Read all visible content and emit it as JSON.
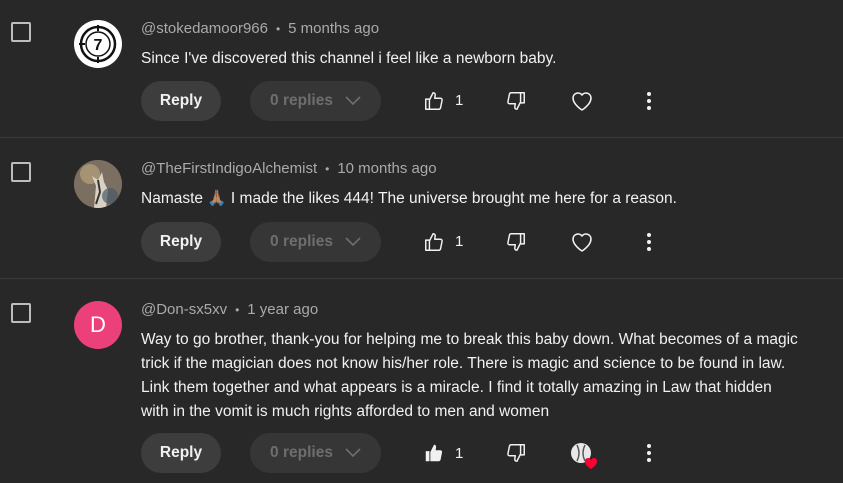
{
  "comments": [
    {
      "author": "@stokedamoor966",
      "time": "5 months ago",
      "text": "Since I've discovered this channel i feel like a newborn baby.",
      "avatar": "logo",
      "avatar_logo_text": "7",
      "likes": "1",
      "liked": false,
      "hearted": false
    },
    {
      "author": "@TheFirstIndigoAlchemist",
      "time": "10 months ago",
      "text": "Namaste 🙏🏽 I made the likes 444! The universe brought me here for a reason.",
      "avatar": "photo",
      "likes": "1",
      "liked": false,
      "hearted": false
    },
    {
      "author": "@Don-sx5xv",
      "time": "1 year ago",
      "text": "Way to go brother, thank-you for helping me to break this baby down. What becomes of a magic trick if the magician does not know his/her role. There is magic and science to be found in law. Link them together and what appears is a miracle. I find it totally amazing in Law that hidden with in the vomit is much rights afforded to men and women",
      "avatar": "letter",
      "avatar_letter": "D",
      "avatar_color": "#ec407a",
      "likes": "1",
      "liked": true,
      "hearted": true
    }
  ],
  "buttons": {
    "reply_label": "Reply",
    "replies_label": "0 replies"
  },
  "icons": {
    "like": "thumbs-up-icon",
    "dislike": "thumbs-down-icon",
    "heart": "heart-icon",
    "more": "more-vert-icon",
    "chevron": "chevron-down-icon"
  },
  "colors": {
    "background": "#282828",
    "divider": "#3a3a3a",
    "text_primary": "#f1f1f1",
    "text_secondary": "#aaaaaa",
    "button_bg": "#3d3d3d",
    "heart_red": "#ff0033"
  }
}
